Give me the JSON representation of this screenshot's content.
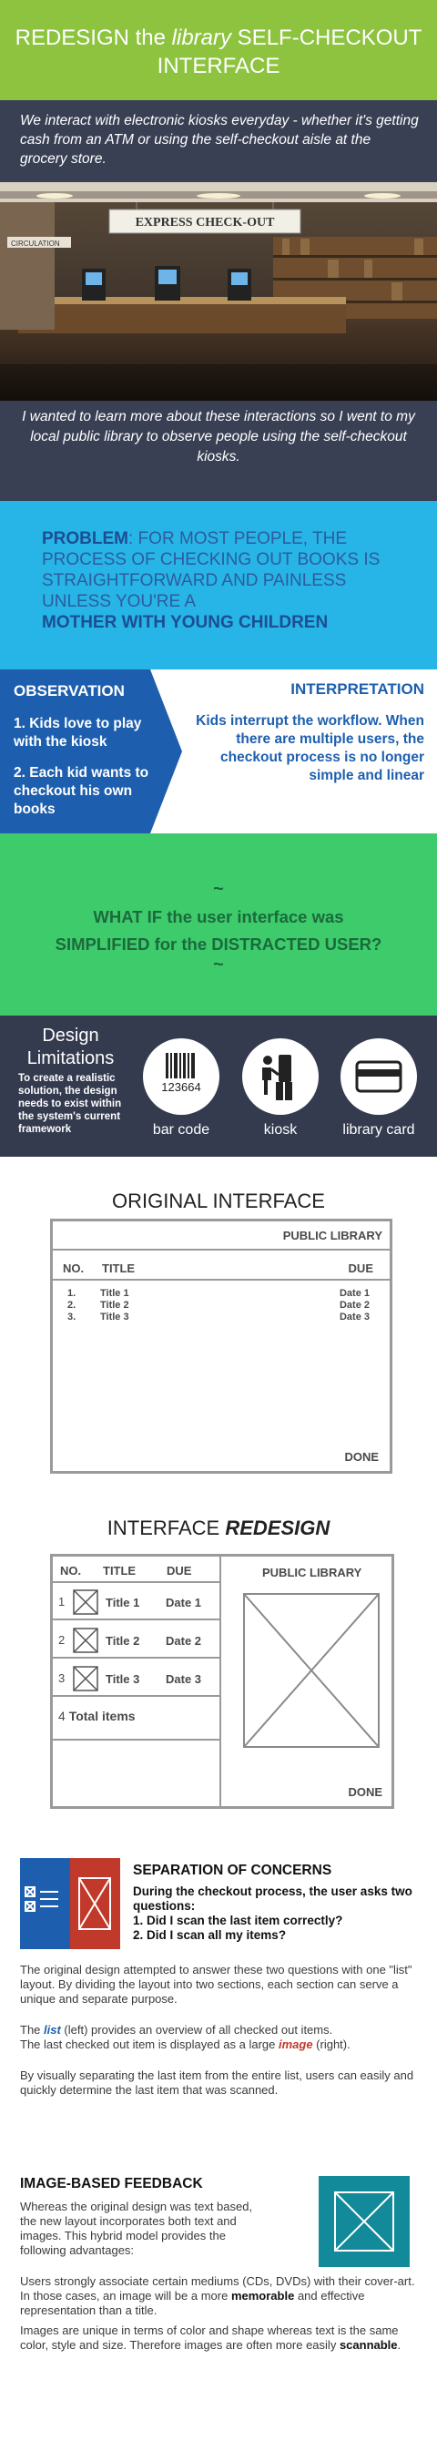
{
  "header": {
    "title_pre": "REDESIGN the ",
    "title_em": "library",
    "title_post": " SELF-CHECKOUT",
    "title_line2": "INTERFACE"
  },
  "intro": {
    "quote": "We interact with electronic kiosks everyday - whether it's getting cash from an ATM or using the self-checkout aisle at the grocery store.",
    "photo_sign_main": "EXPRESS CHECK-OUT",
    "photo_sign_left": "CIRCULATION",
    "text": "I wanted to learn more about these interactions so I went to my local public library to  observe people using the self-checkout kiosks."
  },
  "problem": {
    "label": "PROBLEM",
    "text": ": For most people, the process of checking out books is straightforward and painless unless you're a",
    "emphasis": "mother with young children"
  },
  "observation": {
    "heading": "OBSERVATION",
    "items": [
      "1. Kids love to play with the kiosk",
      "2. Each kid wants to checkout his own books"
    ],
    "interp_heading": "INTERPRETATION",
    "interp_text": "Kids interrupt the workflow. When there are multiple users, the checkout process is no longer simple and linear"
  },
  "whatif": {
    "tilde": "~",
    "line1": "WHAT IF the user interface was",
    "line2": "SIMPLIFIED for the DISTRACTED USER?"
  },
  "limits": {
    "heading_l1": "Design",
    "heading_l2": "Limitations",
    "text": "To create a realistic solution, the design needs to exist within the system's current framework",
    "barcode_number": "123664",
    "icons": [
      {
        "label": "bar code",
        "icon": "barcode-icon"
      },
      {
        "label": "kiosk",
        "icon": "kiosk-icon"
      },
      {
        "label": "library card",
        "icon": "library-card-icon"
      }
    ]
  },
  "original": {
    "heading": "ORIGINAL INTERFACE",
    "header": "PUBLIC LIBRARY",
    "col_no": "NO.",
    "col_title": "TITLE",
    "col_due": "DUE",
    "rows": [
      {
        "no": "1.",
        "title": "Title 1",
        "due": "Date 1"
      },
      {
        "no": "2.",
        "title": "Title 2",
        "due": "Date 2"
      },
      {
        "no": "3.",
        "title": "Title 3",
        "due": "Date 3"
      }
    ],
    "done": "DONE"
  },
  "redesign": {
    "heading_pre": "INTERFACE ",
    "heading_em": "REDESIGN",
    "col_no": "NO.",
    "col_title": "TITLE",
    "col_due": "DUE",
    "header": "PUBLIC LIBRARY",
    "rows": [
      {
        "no": "1",
        "title": "Title 1",
        "due": "Date 1"
      },
      {
        "no": "2",
        "title": "Title 2",
        "due": "Date 2"
      },
      {
        "no": "3",
        "title": "Title 3",
        "due": "Date 3"
      }
    ],
    "total_no": "4",
    "total_label": "Total items",
    "done": "DONE"
  },
  "separation": {
    "heading": "SEPARATION OF CONCERNS",
    "lead": "During the checkout process, the user asks two questions:",
    "q1": "1. Did I scan the last item correctly?",
    "q2": "2. Did I scan all my items?",
    "p1": "The original design attempted to answer these two questions with one \"list\" layout. By dividing the layout into two sections, each section can serve a unique and separate purpose.",
    "p2_a": "The ",
    "p2_list": "list",
    "p2_b": " (left) provides an overview of all checked out items.",
    "p2_c": "The last checked out item is displayed as a large ",
    "p2_image": "image",
    "p2_d": " (right).",
    "p3": "By visually separating the last item from the entire list, users can easily and quickly determine the last item that was scanned."
  },
  "image_feedback": {
    "heading": "IMAGE-BASED FEEDBACK",
    "p1": "Whereas the original design was text based, the new layout incorporates both text and images. This hybrid model provides the following advantages:",
    "p2_a": "Users strongly associate certain mediums (CDs, DVDs) with their cover-art. In those cases, an image will be a more ",
    "p2_b": "memorable",
    "p2_c": " and effective representation than a title.",
    "p3_a": "Images are unique in terms of color and shape whereas text is the same color, style and size.  Therefore images are often more easily ",
    "p3_b": "scannable",
    "p3_c": "."
  },
  "colors": {
    "green": "#8dc33f",
    "navy": "#394054",
    "sky": "#27b4e6",
    "blue": "#1d5fae",
    "mint": "#3ecb6c",
    "red": "#c0392b",
    "teal": "#128a99"
  }
}
